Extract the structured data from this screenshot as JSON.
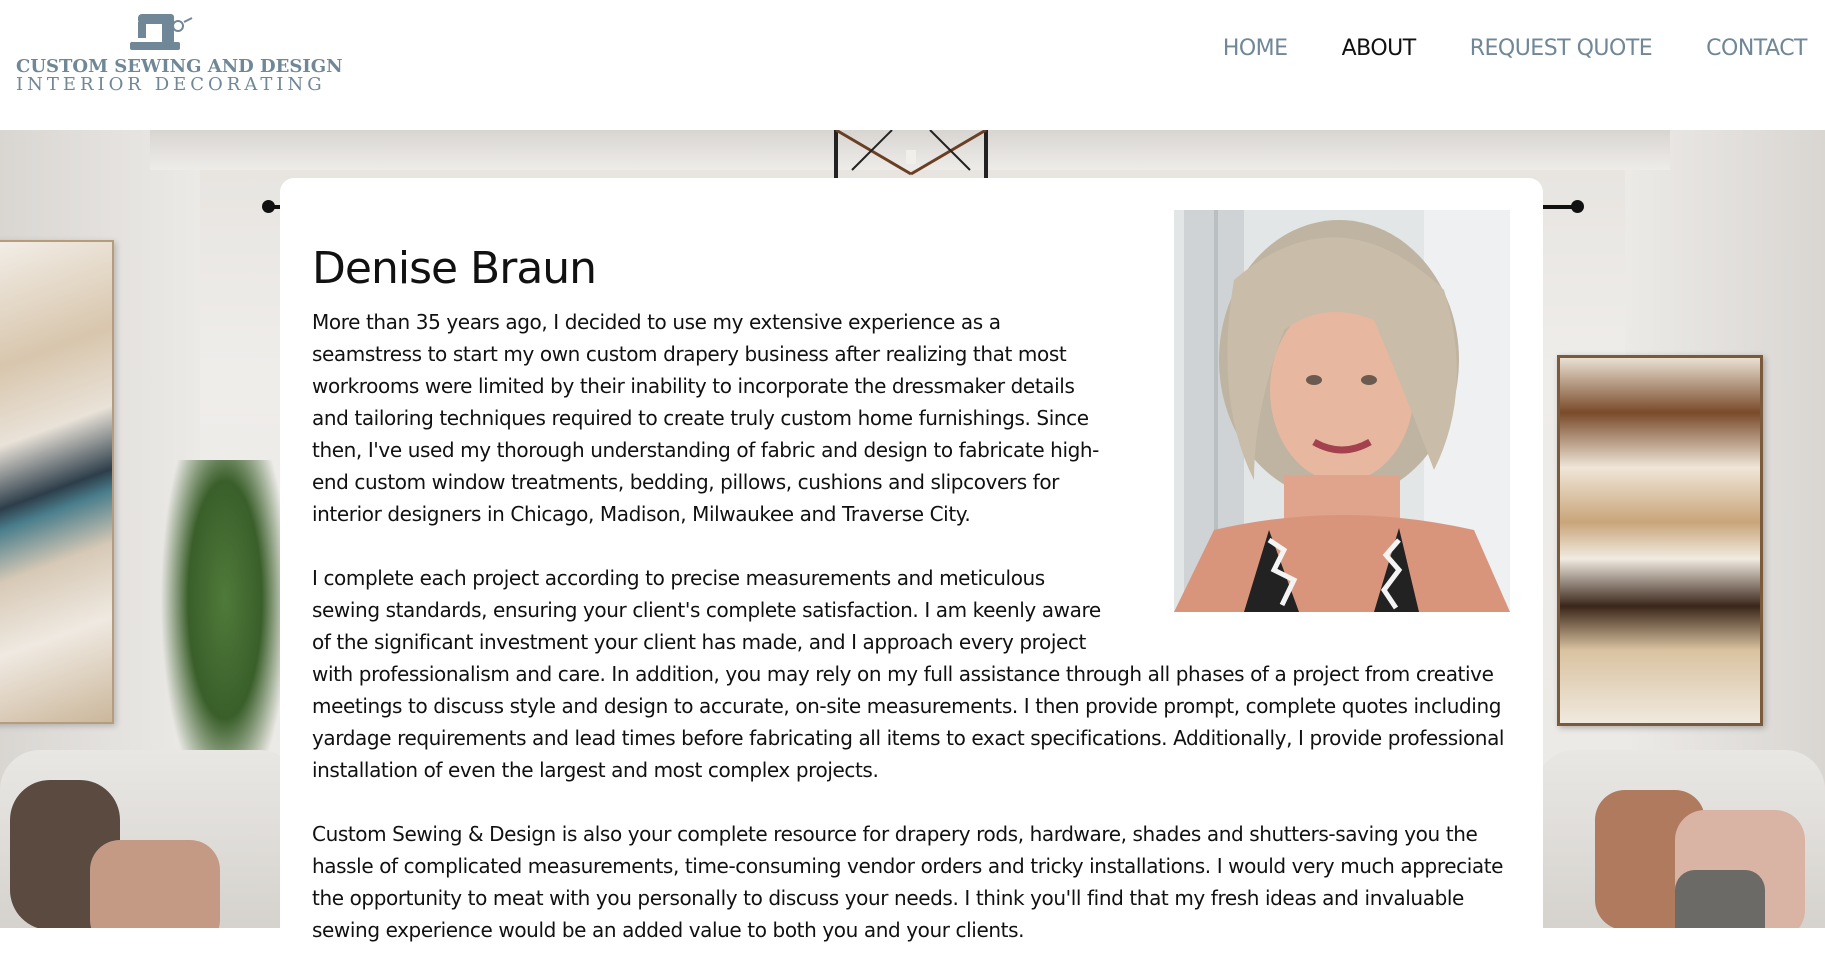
{
  "logo": {
    "line1": "CUSTOM SEWING AND DESIGN",
    "line2": "INTERIOR DECORATING",
    "icon": "sewing-machine-icon",
    "color": "#6f8796"
  },
  "nav": {
    "items": [
      {
        "label": "HOME",
        "active": false
      },
      {
        "label": "ABOUT",
        "active": true
      },
      {
        "label": "REQUEST QUOTE",
        "active": false
      },
      {
        "label": "CONTACT",
        "active": false
      }
    ],
    "color": "#6f8796",
    "active_color": "#111111"
  },
  "about": {
    "name": "Denise Braun",
    "paragraphs": [
      "More than 35 years ago, I decided to use my extensive experience as a seamstress to start my own custom drapery business after realizing that most workrooms were limited by their inability to incorporate the dressmaker details and tailoring techniques required to create truly custom home furnishings. Since then, I've used my thorough understanding of fabric and design to fabricate high-end custom window treatments, bedding, pillows, cushions and slipcovers for interior designers in Chicago, Madison, Milwaukee and Traverse City.",
      "I complete each project according to precise measurements and meticulous sewing standards, ensuring your client's complete satisfaction. I am keenly aware of the significant investment your client has made, and I approach every project with professionalism and care. In addition, you may rely on my full assistance through all phases of a project from creative meetings to discuss style and design to accurate, on-site measurements. I then provide prompt, complete quotes including yardage requirements and lead times before fabricating all items to exact specifications. Additionally, I provide professional installation of even the largest and most complex projects.",
      "Custom Sewing & Design is also your complete resource for drapery rods, hardware, shades and shutters-saving you the hassle of complicated measurements, time-consuming vendor orders and tricky installations. I would very much appreciate the opportunity to meat with you personally to discuss your needs. I think you'll find that my fresh ideas and invaluable sewing experience would be an added value to both you and your clients."
    ]
  }
}
